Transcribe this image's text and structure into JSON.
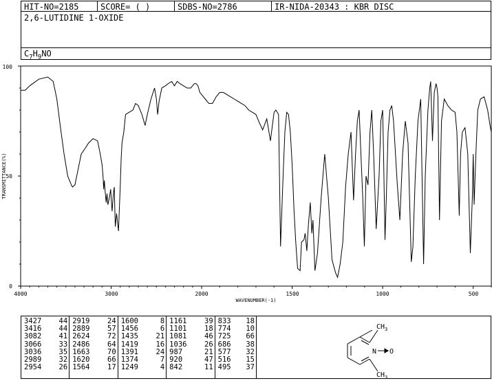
{
  "header": {
    "hit_no": "HIT-NO=2185",
    "score": "SCORE=  (   )",
    "sdbs_no": "SDBS-NO=2786",
    "ir_no": "IR-NIDA-20343 : KBR DISC"
  },
  "compound": {
    "name": "2,6-LUTIDINE 1-OXIDE",
    "formula": "C7H9NO",
    "formula_parts": {
      "c": "C",
      "c_sub": "7",
      "h": "H",
      "h_sub": "9",
      "rest": "NO"
    }
  },
  "structure": {
    "top_group": "CH",
    "top_sub": "3",
    "bottom_group": "CH",
    "bottom_sub": "3",
    "n_label": "N",
    "o_label": "O"
  },
  "chart_data": {
    "type": "line",
    "xlabel": "WAVENUMBER(-1)",
    "ylabel": "TRANSMITTANCE(%)",
    "xlim": [
      4000,
      400
    ],
    "ylim": [
      0,
      100
    ],
    "x_ticks": [
      "4000",
      "3000",
      "2000",
      "1500",
      "1000",
      "500"
    ],
    "y_ticks": [
      "100",
      "50",
      "0"
    ],
    "x_scale": "linear above 2000, linear below 2000 (two-scale IR axis)",
    "grid": false,
    "series": [
      {
        "points": [
          [
            4000,
            89
          ],
          [
            3950,
            89
          ],
          [
            3900,
            91
          ],
          [
            3800,
            94
          ],
          [
            3700,
            95
          ],
          [
            3640,
            93
          ],
          [
            3600,
            85
          ],
          [
            3560,
            72
          ],
          [
            3520,
            60
          ],
          [
            3480,
            50
          ],
          [
            3440,
            46
          ],
          [
            3427,
            45
          ],
          [
            3400,
            46
          ],
          [
            3370,
            52
          ],
          [
            3330,
            60
          ],
          [
            3280,
            63
          ],
          [
            3250,
            65
          ],
          [
            3200,
            67
          ],
          [
            3150,
            66
          ],
          [
            3120,
            60
          ],
          [
            3100,
            55
          ],
          [
            3090,
            50
          ],
          [
            3082,
            44
          ],
          [
            3075,
            48
          ],
          [
            3066,
            43
          ],
          [
            3055,
            38
          ],
          [
            3046,
            42
          ],
          [
            3036,
            37
          ],
          [
            3020,
            40
          ],
          [
            3005,
            44
          ],
          [
            2989,
            34
          ],
          [
            2975,
            42
          ],
          [
            2965,
            45
          ],
          [
            2954,
            27
          ],
          [
            2940,
            33
          ],
          [
            2919,
            25
          ],
          [
            2900,
            45
          ],
          [
            2889,
            58
          ],
          [
            2880,
            65
          ],
          [
            2860,
            70
          ],
          [
            2840,
            78
          ],
          [
            2800,
            79
          ],
          [
            2760,
            80
          ],
          [
            2730,
            83
          ],
          [
            2700,
            82
          ],
          [
            2660,
            78
          ],
          [
            2624,
            73
          ],
          [
            2600,
            78
          ],
          [
            2560,
            85
          ],
          [
            2520,
            90
          ],
          [
            2500,
            85
          ],
          [
            2486,
            78
          ],
          [
            2470,
            84
          ],
          [
            2440,
            90
          ],
          [
            2400,
            91
          ],
          [
            2370,
            92
          ],
          [
            2330,
            93
          ],
          [
            2300,
            91
          ],
          [
            2270,
            93
          ],
          [
            2240,
            92
          ],
          [
            2200,
            91
          ],
          [
            2160,
            90
          ],
          [
            2120,
            90
          ],
          [
            2080,
            92
          ],
          [
            2060,
            92
          ],
          [
            2040,
            91
          ],
          [
            2020,
            88
          ],
          [
            2000,
            87
          ],
          [
            1980,
            85
          ],
          [
            1960,
            83
          ],
          [
            1940,
            83
          ],
          [
            1920,
            86
          ],
          [
            1900,
            88
          ],
          [
            1880,
            88
          ],
          [
            1860,
            87
          ],
          [
            1840,
            86
          ],
          [
            1820,
            85
          ],
          [
            1800,
            84
          ],
          [
            1780,
            83
          ],
          [
            1760,
            82
          ],
          [
            1740,
            80
          ],
          [
            1720,
            79
          ],
          [
            1700,
            78
          ],
          [
            1680,
            74
          ],
          [
            1663,
            71
          ],
          [
            1640,
            76
          ],
          [
            1620,
            66
          ],
          [
            1600,
            79
          ],
          [
            1590,
            80
          ],
          [
            1575,
            78
          ],
          [
            1564,
            18
          ],
          [
            1550,
            50
          ],
          [
            1540,
            70
          ],
          [
            1530,
            79
          ],
          [
            1520,
            78
          ],
          [
            1510,
            70
          ],
          [
            1500,
            55
          ],
          [
            1490,
            35
          ],
          [
            1480,
            20
          ],
          [
            1470,
            8
          ],
          [
            1456,
            7
          ],
          [
            1448,
            20
          ],
          [
            1435,
            21
          ],
          [
            1428,
            24
          ],
          [
            1419,
            16
          ],
          [
            1410,
            28
          ],
          [
            1400,
            38
          ],
          [
            1391,
            24
          ],
          [
            1385,
            30
          ],
          [
            1374,
            7
          ],
          [
            1360,
            15
          ],
          [
            1340,
            40
          ],
          [
            1320,
            60
          ],
          [
            1300,
            40
          ],
          [
            1280,
            12
          ],
          [
            1260,
            6
          ],
          [
            1249,
            4
          ],
          [
            1235,
            10
          ],
          [
            1220,
            20
          ],
          [
            1205,
            45
          ],
          [
            1190,
            60
          ],
          [
            1175,
            70
          ],
          [
            1161,
            39
          ],
          [
            1150,
            60
          ],
          [
            1140,
            75
          ],
          [
            1130,
            80
          ],
          [
            1120,
            60
          ],
          [
            1110,
            40
          ],
          [
            1101,
            18
          ],
          [
            1092,
            50
          ],
          [
            1081,
            46
          ],
          [
            1070,
            70
          ],
          [
            1060,
            80
          ],
          [
            1050,
            60
          ],
          [
            1036,
            26
          ],
          [
            1020,
            50
          ],
          [
            1010,
            75
          ],
          [
            1000,
            80
          ],
          [
            995,
            60
          ],
          [
            987,
            21
          ],
          [
            980,
            40
          ],
          [
            970,
            70
          ],
          [
            960,
            80
          ],
          [
            950,
            82
          ],
          [
            940,
            75
          ],
          [
            920,
            47
          ],
          [
            905,
            30
          ],
          [
            890,
            60
          ],
          [
            875,
            75
          ],
          [
            860,
            65
          ],
          [
            842,
            11
          ],
          [
            833,
            18
          ],
          [
            820,
            50
          ],
          [
            805,
            75
          ],
          [
            790,
            85
          ],
          [
            774,
            10
          ],
          [
            765,
            50
          ],
          [
            750,
            80
          ],
          [
            740,
            90
          ],
          [
            735,
            93
          ],
          [
            725,
            66
          ],
          [
            715,
            88
          ],
          [
            705,
            92
          ],
          [
            700,
            90
          ],
          [
            695,
            86
          ],
          [
            686,
            30
          ],
          [
            675,
            75
          ],
          [
            660,
            85
          ],
          [
            640,
            82
          ],
          [
            620,
            80
          ],
          [
            600,
            79
          ],
          [
            590,
            70
          ],
          [
            577,
            32
          ],
          [
            570,
            60
          ],
          [
            560,
            70
          ],
          [
            545,
            72
          ],
          [
            530,
            60
          ],
          [
            516,
            15
          ],
          [
            505,
            40
          ],
          [
            500,
            60
          ],
          [
            495,
            37
          ],
          [
            485,
            60
          ],
          [
            475,
            80
          ],
          [
            460,
            85
          ],
          [
            440,
            86
          ],
          [
            420,
            80
          ],
          [
            405,
            72
          ],
          [
            400,
            70
          ]
        ]
      }
    ]
  },
  "peak_table": [
    [
      [
        "3427",
        "44"
      ],
      [
        "3416",
        "44"
      ],
      [
        "3082",
        "41"
      ],
      [
        "3066",
        "33"
      ],
      [
        "3036",
        "35"
      ],
      [
        "2989",
        "32"
      ],
      [
        "2954",
        "26"
      ]
    ],
    [
      [
        "2919",
        "24"
      ],
      [
        "2889",
        "57"
      ],
      [
        "2624",
        "72"
      ],
      [
        "2486",
        "64"
      ],
      [
        "1663",
        "70"
      ],
      [
        "1620",
        "66"
      ],
      [
        "1564",
        "17"
      ]
    ],
    [
      [
        "1600",
        "8"
      ],
      [
        "1456",
        "6"
      ],
      [
        "1435",
        "21"
      ],
      [
        "1419",
        "16"
      ],
      [
        "1391",
        "24"
      ],
      [
        "1374",
        "7"
      ],
      [
        "1249",
        "4"
      ]
    ],
    [
      [
        "1161",
        "39"
      ],
      [
        "1101",
        "18"
      ],
      [
        "1081",
        "46"
      ],
      [
        "1036",
        "26"
      ],
      [
        "987",
        "21"
      ],
      [
        "920",
        "47"
      ],
      [
        "842",
        "11"
      ]
    ],
    [
      [
        "833",
        "18"
      ],
      [
        "774",
        "10"
      ],
      [
        "725",
        "66"
      ],
      [
        "686",
        "38"
      ],
      [
        "577",
        "32"
      ],
      [
        "516",
        "15"
      ],
      [
        "495",
        "37"
      ]
    ]
  ]
}
